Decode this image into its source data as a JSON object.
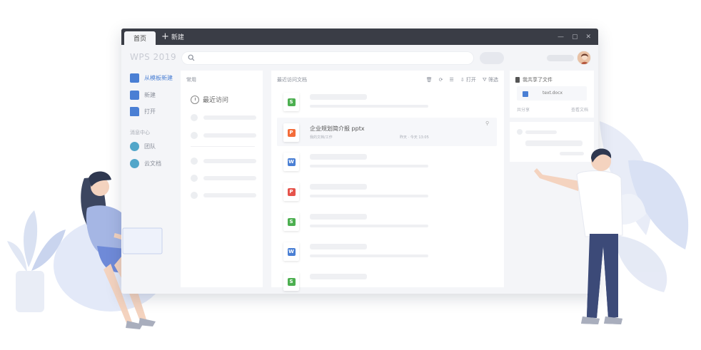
{
  "window": {
    "tab_home": "首页",
    "tab_new": "新建",
    "logo": "WPS 2019",
    "controls": [
      "—",
      "▢",
      "✕"
    ]
  },
  "leftnav": {
    "template_label": "从模板新建",
    "new_label": "新建",
    "open_label": "打开",
    "section_label": "消息中心",
    "team_label": "团队",
    "cloud_label": "云文档"
  },
  "location_panel": {
    "title": "常用",
    "recent_visit": "最近访问"
  },
  "files_panel": {
    "title": "最近访问文档",
    "open_label": "打开",
    "filter_label": "筛选",
    "highlight_file": {
      "name": "企业规划简介报 pptx",
      "meta_path": "我的文档/工作",
      "meta_time": "昨天 · 今天 13:05"
    },
    "file_types": [
      {
        "type": "spreadsheet",
        "letter": "S",
        "color": "#4caf50"
      },
      {
        "type": "presentation",
        "letter": "P",
        "color": "#f36c3a"
      },
      {
        "type": "writer",
        "letter": "W",
        "color": "#4a7fd4"
      },
      {
        "type": "pdf",
        "letter": "P",
        "color": "#e5534b"
      },
      {
        "type": "spreadsheet",
        "letter": "S",
        "color": "#4caf50"
      },
      {
        "type": "writer",
        "letter": "W",
        "color": "#4a7fd4"
      },
      {
        "type": "spreadsheet",
        "letter": "S",
        "color": "#4caf50"
      }
    ]
  },
  "shared_panel": {
    "title": "我共享了文件",
    "file_name": "text.docx",
    "foot_left": "共分享",
    "foot_right": "查看文档"
  },
  "colors": {
    "titlebar": "#3a3d46",
    "accent_blue": "#4a7fd4",
    "accent_teal": "#52a6c9"
  }
}
